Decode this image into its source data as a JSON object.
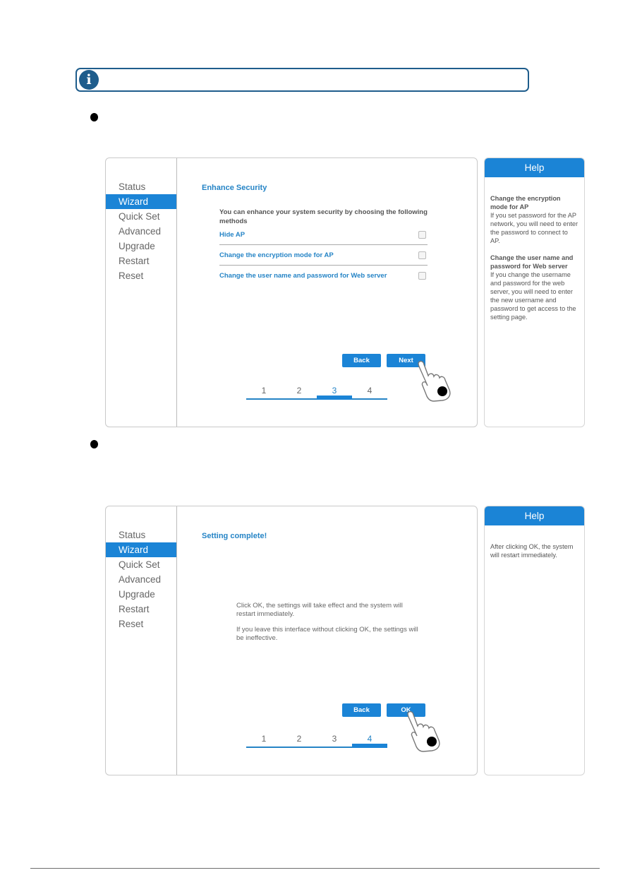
{
  "note": {
    "icon": "info-icon",
    "text": ""
  },
  "steps_doc": [
    {
      "bullet": "",
      "panel": {
        "sidebar": [
          "Status",
          "Wizard",
          "Quick Set",
          "Advanced",
          "Upgrade",
          "Restart",
          "Reset"
        ],
        "active": "Wizard",
        "title": "Enhance Security",
        "intro": "You can enhance your system security by choosing the following methods",
        "options": [
          {
            "label": "Hide AP",
            "checked": false
          },
          {
            "label": "Change the encryption mode for AP",
            "checked": false
          },
          {
            "label": "Change the user name and password for Web server",
            "checked": false
          }
        ],
        "buttons": {
          "back": "Back",
          "next": "Next"
        },
        "wizard_steps": [
          "1",
          "2",
          "3",
          "4"
        ],
        "current_step": 3,
        "help": {
          "header": "Help",
          "sections": [
            {
              "heading": "Change the encryption mode for AP",
              "text": "If you set password for the AP network, you will need to enter the password to connect to AP."
            },
            {
              "heading": "Change the user name and password for Web server",
              "text": "If you change the username and password for the web server, you will need to enter the new username and password to get access to the setting page."
            }
          ]
        }
      }
    },
    {
      "bullet": "",
      "panel": {
        "sidebar": [
          "Status",
          "Wizard",
          "Quick Set",
          "Advanced",
          "Upgrade",
          "Restart",
          "Reset"
        ],
        "active": "Wizard",
        "title": "Setting complete!",
        "paragraphs": [
          "Click OK, the settings will take effect and the system will restart immediately.",
          "If you leave this interface without clicking OK, the settings will be ineffective."
        ],
        "buttons": {
          "back": "Back",
          "ok": "OK"
        },
        "wizard_steps": [
          "1",
          "2",
          "3",
          "4"
        ],
        "current_step": 4,
        "help": {
          "header": "Help",
          "text": "After clicking OK, the system will restart immediately."
        }
      }
    }
  ]
}
